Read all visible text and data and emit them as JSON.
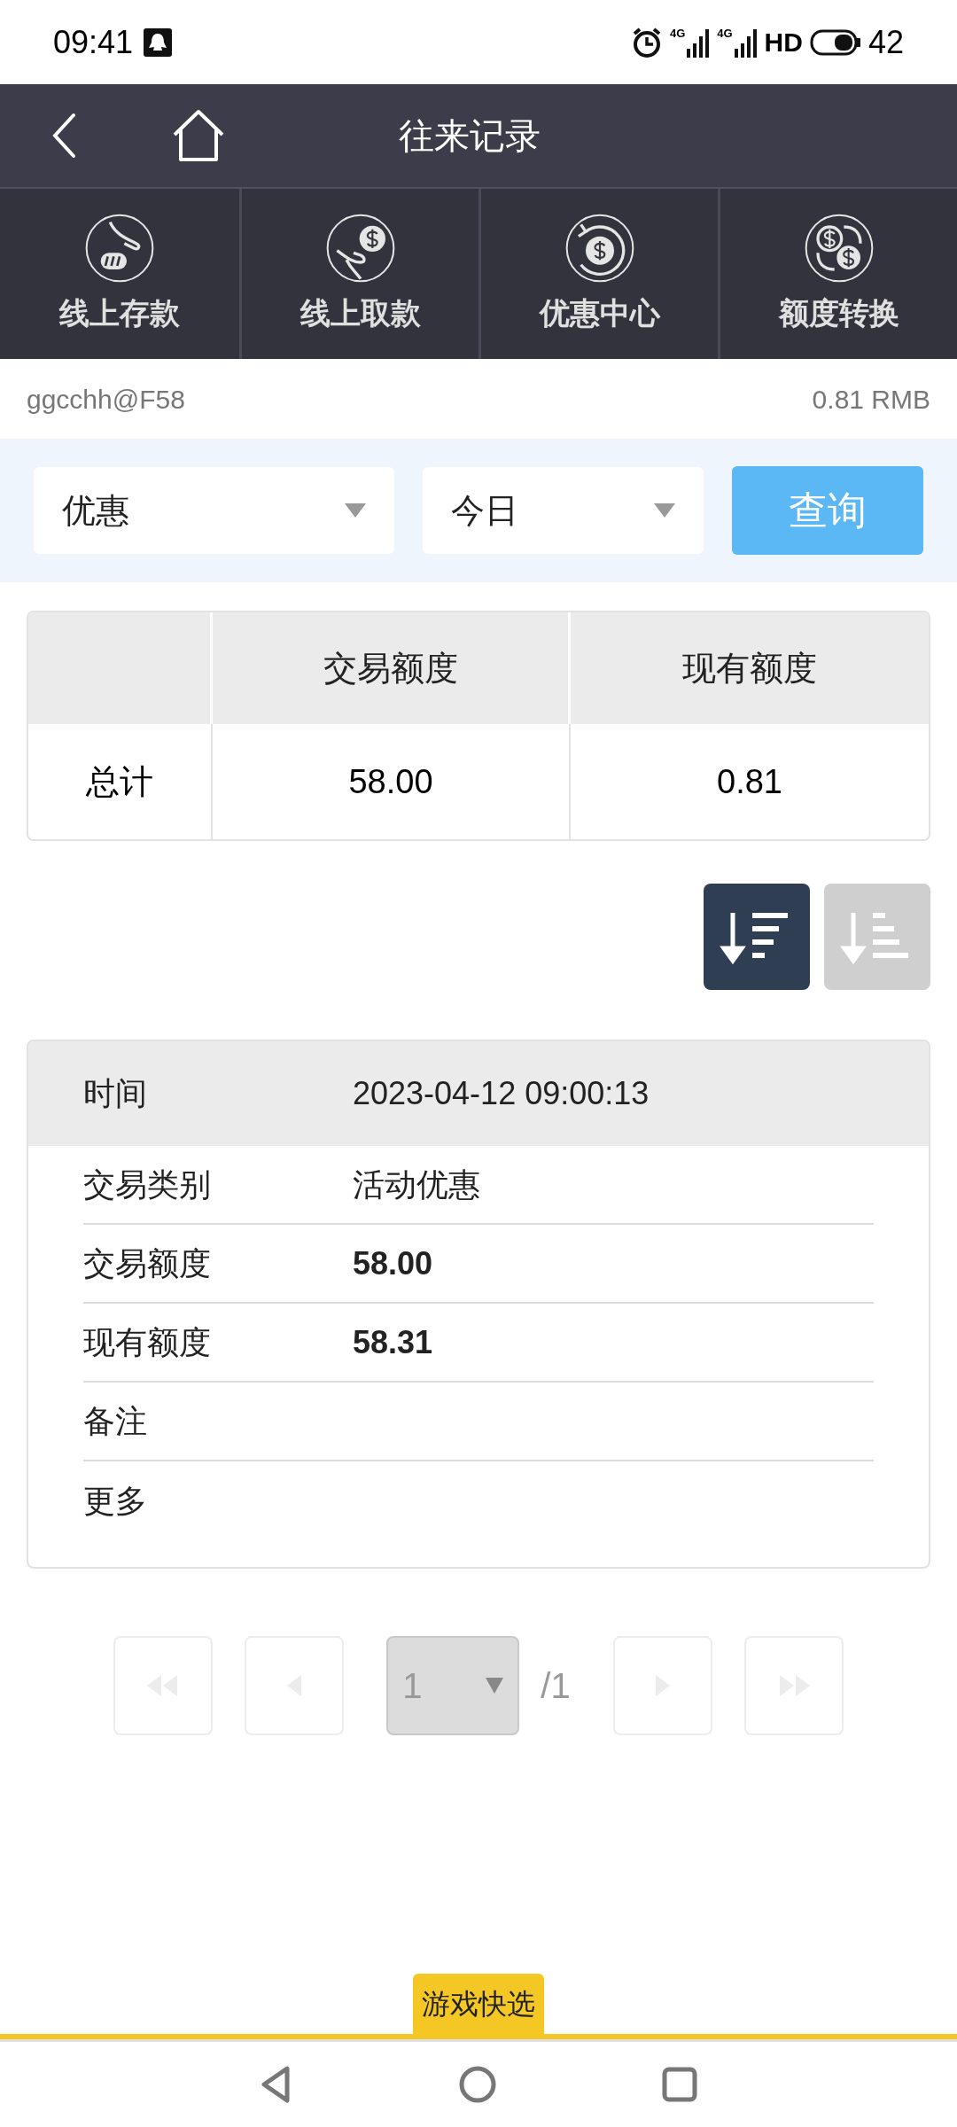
{
  "status_bar": {
    "time": "09:41",
    "network_labels": [
      "4G",
      "4G"
    ],
    "hd_label": "HD",
    "battery": "42"
  },
  "header": {
    "title": "往来记录"
  },
  "nav_items": [
    {
      "label": "线上存款",
      "kind": "deposit"
    },
    {
      "label": "线上取款",
      "kind": "withdraw"
    },
    {
      "label": "优惠中心",
      "kind": "promo"
    },
    {
      "label": "额度转换",
      "kind": "transfer"
    }
  ],
  "account": {
    "username": "ggcchh@F58",
    "balance": "0.81 RMB"
  },
  "filters": {
    "type": "优惠",
    "period": "今日",
    "query_button": "查询"
  },
  "summary_table": {
    "columns": [
      "交易额度",
      "现有额度"
    ],
    "rows": [
      {
        "label": "总计",
        "cells": [
          "58.00",
          "0.81"
        ]
      }
    ]
  },
  "sort_buttons": [
    {
      "kind": "descending",
      "selected": true
    },
    {
      "kind": "ascending",
      "selected": false
    }
  ],
  "record": {
    "header": {
      "label": "时间",
      "value": "2023-04-12 09:00:13"
    },
    "rows": [
      {
        "label": "交易类别",
        "value": "活动优惠",
        "bold": false
      },
      {
        "label": "交易额度",
        "value": "58.00",
        "bold": true
      },
      {
        "label": "现有额度",
        "value": "58.31",
        "bold": true
      },
      {
        "label": "备注"
      },
      {
        "label": "更多"
      }
    ]
  },
  "pagination": {
    "page": "1",
    "total": "/1",
    "buttons": [
      {
        "kind": "first",
        "disabled": true
      },
      {
        "kind": "prev",
        "disabled": true
      },
      {
        "kind": "next",
        "disabled": true
      },
      {
        "kind": "last",
        "disabled": true
      }
    ]
  },
  "quick_tab": {
    "label": "游戏快选"
  }
}
